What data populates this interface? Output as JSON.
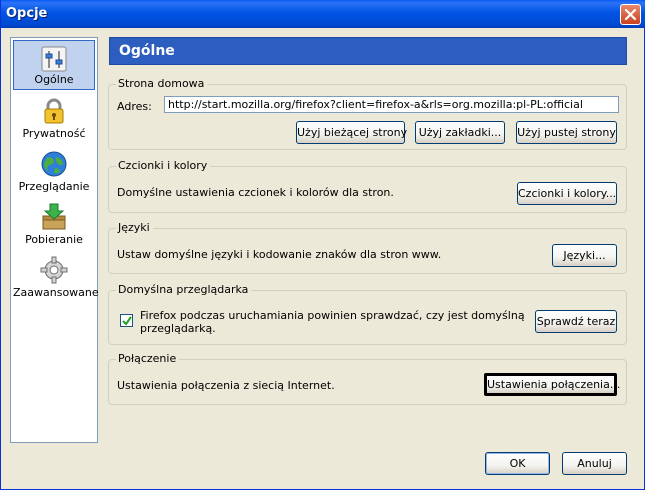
{
  "window": {
    "title": "Opcje"
  },
  "sidebar": {
    "items": [
      {
        "label": "Ogólne",
        "icon": "general-icon",
        "active": true
      },
      {
        "label": "Prywatność",
        "icon": "padlock-icon",
        "active": false
      },
      {
        "label": "Przeglądanie",
        "icon": "globe-icon",
        "active": false
      },
      {
        "label": "Pobieranie",
        "icon": "download-box-icon",
        "active": false
      },
      {
        "label": "Zaawansowane",
        "icon": "gear-icon",
        "active": false
      }
    ]
  },
  "header": {
    "title": "Ogólne"
  },
  "homepage": {
    "group_title": "Strona domowa",
    "address_label": "Adres:",
    "address_value": "http://start.mozilla.org/firefox?client=firefox-a&rls=org.mozilla:pl-PL:official",
    "btn_current": "Użyj bieżącej strony",
    "btn_bookmark": "Użyj zakładki...",
    "btn_blank": "Użyj pustej strony"
  },
  "fonts": {
    "group_title": "Czcionki i kolory",
    "description": "Domyślne ustawienia czcionek i kolorów dla stron.",
    "button": "Czcionki i kolory..."
  },
  "languages": {
    "group_title": "Języki",
    "description": "Ustaw domyślne języki i kodowanie znaków dla stron www.",
    "button": "Języki..."
  },
  "default_browser": {
    "group_title": "Domyślna przeglądarka",
    "checkbox_line1": "Firefox podczas uruchamiania powinien sprawdzać, czy jest domyślną",
    "checkbox_line2": "przeglądarką.",
    "checked": true,
    "button": "Sprawdź teraz"
  },
  "connection": {
    "group_title": "Połączenie",
    "description": "Ustawienia połączenia z siecią Internet.",
    "button": "Ustawienia połączenia..."
  },
  "footer": {
    "ok": "OK",
    "cancel": "Anuluj"
  },
  "colors": {
    "titlebar": "#0054e3",
    "header": "#2c5ebf",
    "selection": "#c1d2ee",
    "dialog_bg": "#ece9d8"
  }
}
